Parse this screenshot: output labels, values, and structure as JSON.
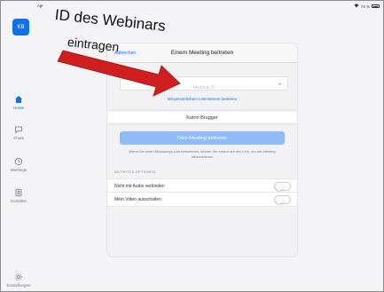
{
  "statusbar": {
    "time": "09:46  Sonntag 18. Apr",
    "battery": "74 %"
  },
  "sidebar": {
    "avatar_initials": "KB",
    "items": [
      {
        "label": "Home",
        "icon": "home-icon",
        "active": true
      },
      {
        "label": "Chats",
        "icon": "chat-icon",
        "active": false
      },
      {
        "label": "Meetings",
        "icon": "clock-icon",
        "active": false
      },
      {
        "label": "Kontakte",
        "icon": "contacts-icon",
        "active": false
      }
    ],
    "settings_label": "Einstellungen"
  },
  "annotation": {
    "line1": "ID des Webinars",
    "line2": "eintragen"
  },
  "dialog": {
    "cancel_label": "Abbrechen",
    "title": "Einem Meeting beitreten",
    "meeting_id_placeholder": "Meeting-ID",
    "personal_link_label": "Mit persönlichem Link-Namen beitreten",
    "name_value": "Katrin Brugger",
    "join_button_label": "Dem Meeting beitreten",
    "invite_note": "Wenn Sie einen Einladungs-Link bekommen, klicken Sie erneut auf den Link, um am Meeting teilzunehmen",
    "options_title": "BEITRITTS-OPTIONEN",
    "options": [
      {
        "label": "Nicht mit Audio verbinden",
        "on": false
      },
      {
        "label": "Mein Video ausschalten",
        "on": false
      }
    ]
  },
  "colors": {
    "accent": "#0e72ed",
    "join_button": "#8ebcf6",
    "arrow": "#d11f1f"
  }
}
